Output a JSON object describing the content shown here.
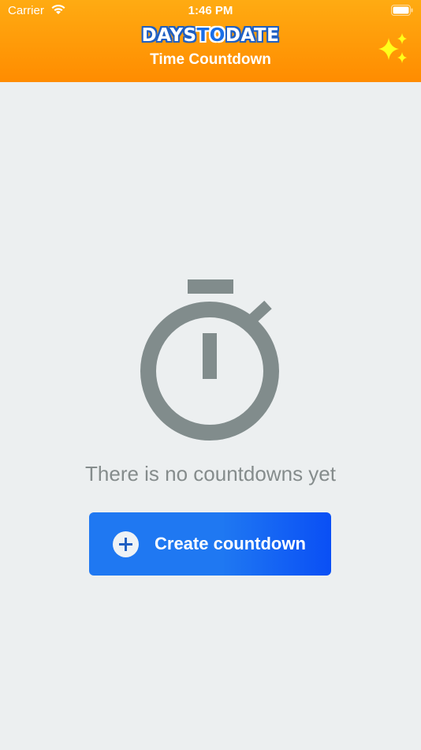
{
  "status_bar": {
    "carrier": "Carrier",
    "time": "1:46 PM"
  },
  "header": {
    "logo": {
      "part1": "DAYS",
      "part2": "TO",
      "part3": "DATE"
    },
    "subtitle": "Time Countdown",
    "icon": "sparkles-icon",
    "background_colors": [
      "#ffab12",
      "#ff8c00"
    ]
  },
  "empty_state": {
    "icon": "stopwatch-icon",
    "message": "There is no countdowns yet",
    "icon_color": "#818c8c"
  },
  "create_button": {
    "label": "Create countdown",
    "icon": "plus-icon",
    "color": "#1f78f2"
  },
  "colors": {
    "background": "#eceff0",
    "sparkle": "#ffff1a"
  }
}
